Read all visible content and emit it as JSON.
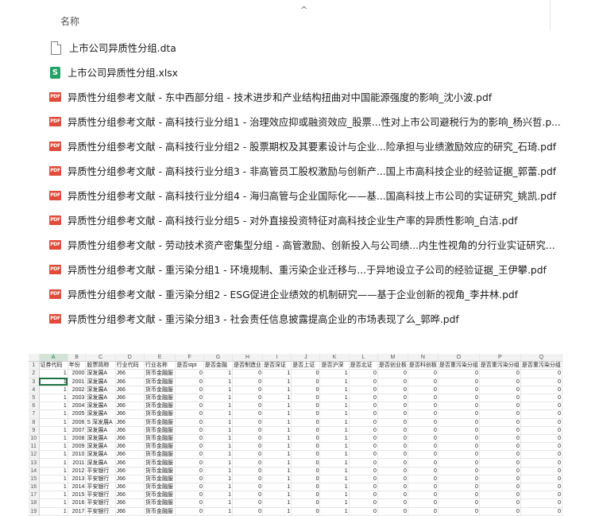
{
  "explorer": {
    "column_header": "名称",
    "sort_indicator": "^",
    "files": [
      {
        "name": "上市公司异质性分组.dta",
        "icon": "document-icon"
      },
      {
        "name": "上市公司异质性分组.xlsx",
        "icon": "spreadsheet-icon"
      },
      {
        "name": "异质性分组参考文献 - 东中西部分组 - 技术进步和产业结构扭曲对中国能源强度的影响_沈小波.pdf",
        "icon": "pdf-icon"
      },
      {
        "name": "异质性分组参考文献 - 高科技行业分组1 - 治理效应抑或融资效应_股票...性对上市公司避税行为的影响_杨兴哲.p...",
        "icon": "pdf-icon"
      },
      {
        "name": "异质性分组参考文献 - 高科技行业分组2 - 股票期权及其要素设计与企业...险承担与业绩激励效应的研究_石琦.pdf",
        "icon": "pdf-icon"
      },
      {
        "name": "异质性分组参考文献 - 高科技行业分组3 - 非高管员工股权激励与创新产...国上市高科技企业的经验证据_郭蕾.pdf",
        "icon": "pdf-icon"
      },
      {
        "name": "异质性分组参考文献 - 高科技行业分组4 - 海归高管与企业国际化——基...国高科技上市公司的实证研究_姚凯.pdf",
        "icon": "pdf-icon"
      },
      {
        "name": "异质性分组参考文献 - 高科技行业分组5 - 对外直接投资特征对高科技企业生产率的异质性影响_白洁.pdf",
        "icon": "pdf-icon"
      },
      {
        "name": "异质性分组参考文献 - 劳动技术资产密集型分组 - 高管激励、创新投入与公司绩...内生性视角的分行业实证研究...",
        "icon": "pdf-icon"
      },
      {
        "name": "异质性分组参考文献 - 重污染分组1 - 环境规制、重污染企业迁移与...于异地设立子公司的经验证据_王伊攀.pdf",
        "icon": "pdf-icon"
      },
      {
        "name": "异质性分组参考文献 - 重污染分组2 - ESG促进企业绩效的机制研究——基于企业创新的视角_李井林.pdf",
        "icon": "pdf-icon"
      },
      {
        "name": "异质性分组参考文献 - 重污染分组3 - 社会责任信息披露提高企业的市场表现了么_郭晔.pdf",
        "icon": "pdf-icon"
      }
    ],
    "icon_glyphs": {
      "xls": "S",
      "pdf": "PDF"
    }
  },
  "spreadsheet": {
    "column_letters": [
      "",
      "A",
      "B",
      "C",
      "D",
      "E",
      "F",
      "G",
      "H",
      "I",
      "J",
      "K",
      "L",
      "M",
      "N",
      "O",
      "P",
      "Q"
    ],
    "header_row": [
      "证券代码",
      "年份",
      "股票简称",
      "行业代码",
      "行业名称",
      "是否stpt",
      "是否金融",
      "是否制造业",
      "是否深证",
      "是否上证",
      "是否沪深",
      "是否北证",
      "是否创业板",
      "是否科创板",
      "是否重污染分组",
      "是否重污染分组",
      "是否重污染分组"
    ],
    "rows": [
      [
        "1",
        "2000",
        "深发展A",
        "J66",
        "货币金融服",
        "0",
        "1",
        "0",
        "1",
        "0",
        "1",
        "0",
        "0",
        "0",
        "0",
        "0",
        "0"
      ],
      [
        "1",
        "2001",
        "深发展A",
        "J66",
        "货币金融服",
        "0",
        "1",
        "0",
        "1",
        "0",
        "1",
        "0",
        "0",
        "0",
        "0",
        "0",
        "0"
      ],
      [
        "1",
        "2002",
        "深发展A",
        "J66",
        "货币金融服",
        "0",
        "1",
        "0",
        "1",
        "0",
        "1",
        "0",
        "0",
        "0",
        "0",
        "0",
        "0"
      ],
      [
        "1",
        "2003",
        "深发展A",
        "J66",
        "货币金融服",
        "0",
        "1",
        "0",
        "1",
        "0",
        "1",
        "0",
        "0",
        "0",
        "0",
        "0",
        "0"
      ],
      [
        "1",
        "2004",
        "深发展A",
        "J66",
        "货币金融服",
        "0",
        "1",
        "0",
        "1",
        "0",
        "1",
        "0",
        "0",
        "0",
        "0",
        "0",
        "0"
      ],
      [
        "1",
        "2005",
        "深发展A",
        "J66",
        "货币金融服",
        "0",
        "1",
        "0",
        "1",
        "0",
        "1",
        "0",
        "0",
        "0",
        "0",
        "0",
        "0"
      ],
      [
        "1",
        "2006",
        "S 深发展A",
        "J66",
        "货币金融服",
        "0",
        "1",
        "0",
        "1",
        "0",
        "1",
        "0",
        "0",
        "0",
        "0",
        "0",
        "0"
      ],
      [
        "1",
        "2007",
        "深发展A",
        "J66",
        "货币金融服",
        "0",
        "1",
        "0",
        "1",
        "0",
        "1",
        "0",
        "0",
        "0",
        "0",
        "0",
        "0"
      ],
      [
        "1",
        "2008",
        "深发展A",
        "J66",
        "货币金融服",
        "0",
        "1",
        "0",
        "1",
        "0",
        "1",
        "0",
        "0",
        "0",
        "0",
        "0",
        "0"
      ],
      [
        "1",
        "2009",
        "深发展A",
        "J66",
        "货币金融服",
        "0",
        "1",
        "0",
        "1",
        "0",
        "1",
        "0",
        "0",
        "0",
        "0",
        "0",
        "0"
      ],
      [
        "1",
        "2010",
        "深发展A",
        "J66",
        "货币金融服",
        "0",
        "1",
        "0",
        "1",
        "0",
        "1",
        "0",
        "0",
        "0",
        "0",
        "0",
        "0"
      ],
      [
        "1",
        "2011",
        "深发展A",
        "J66",
        "货币金融服",
        "0",
        "1",
        "0",
        "1",
        "0",
        "1",
        "0",
        "0",
        "0",
        "0",
        "0",
        "0"
      ],
      [
        "1",
        "2012",
        "平安银行",
        "J66",
        "货币金融服",
        "0",
        "1",
        "0",
        "1",
        "0",
        "1",
        "0",
        "0",
        "0",
        "0",
        "0",
        "0"
      ],
      [
        "1",
        "2013",
        "平安银行",
        "J66",
        "货币金融服",
        "0",
        "1",
        "0",
        "1",
        "0",
        "1",
        "0",
        "0",
        "0",
        "0",
        "0",
        "0"
      ],
      [
        "1",
        "2014",
        "平安银行",
        "J66",
        "货币金融服",
        "0",
        "1",
        "0",
        "1",
        "0",
        "1",
        "0",
        "0",
        "0",
        "0",
        "0",
        "0"
      ],
      [
        "1",
        "2015",
        "平安银行",
        "J66",
        "货币金融服",
        "0",
        "1",
        "0",
        "1",
        "0",
        "1",
        "0",
        "0",
        "0",
        "0",
        "0",
        "0"
      ],
      [
        "1",
        "2016",
        "平安银行",
        "J66",
        "货币金融服",
        "0",
        "1",
        "0",
        "1",
        "0",
        "1",
        "0",
        "0",
        "0",
        "0",
        "0",
        "0"
      ],
      [
        "1",
        "2017",
        "平安银行",
        "J66",
        "货币金融服",
        "0",
        "1",
        "0",
        "1",
        "0",
        "1",
        "0",
        "0",
        "0",
        "0",
        "0",
        "0"
      ]
    ]
  }
}
